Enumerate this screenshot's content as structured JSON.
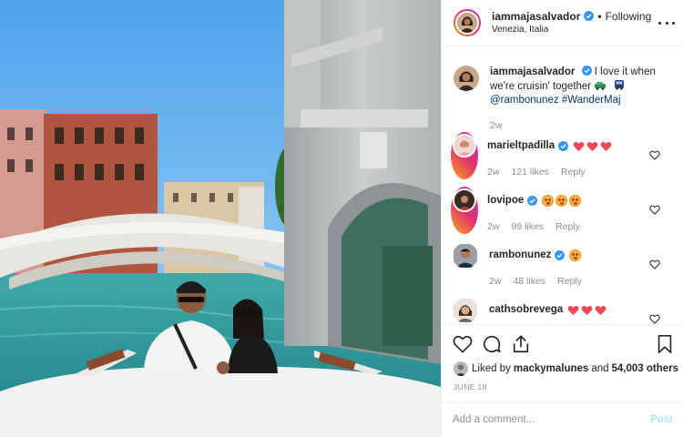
{
  "header": {
    "username": "iammajasalvador",
    "separator": "•",
    "follow_status": "Following",
    "location": "Venezia, Italia"
  },
  "caption": {
    "username": "iammajasalvador",
    "text_1": "I love it when we're cruisin' together",
    "mention": "@rambonunez",
    "hashtag": "#WanderMaj",
    "age": "2w"
  },
  "comments": [
    {
      "username": "marieltpadilla",
      "emoji": [
        "red-heart",
        "red-heart",
        "red-heart"
      ],
      "age": "2w",
      "likes": "121 likes",
      "reply": "Reply",
      "verified": true
    },
    {
      "username": "lovipoe",
      "emoji": [
        "heart-eyes-face",
        "heart-eyes-face",
        "heart-eyes-face"
      ],
      "age": "2w",
      "likes": "99 likes",
      "reply": "Reply",
      "verified": true
    },
    {
      "username": "rambonunez",
      "emoji": [
        "heart-eyes-face"
      ],
      "age": "2w",
      "likes": "48 likes",
      "reply": "Reply",
      "verified": true
    },
    {
      "username": "cathsobrevega",
      "emoji": [
        "red-heart",
        "red-heart",
        "red-heart"
      ],
      "age": "",
      "likes": "",
      "reply": "",
      "verified": false
    }
  ],
  "likes": {
    "prefix": "Liked by",
    "user": "mackymalunes",
    "connector": "and",
    "others": "54,003 others"
  },
  "date": "JUNE 18",
  "add_comment": {
    "placeholder": "Add a comment...",
    "post_label": "Post"
  },
  "colors": {
    "link": "#00376b",
    "muted": "#8e8e8e",
    "verified": "#3897f0",
    "post_disabled": "#b2dffc",
    "heart_emoji": "#ed4956"
  },
  "icons": [
    "verified-badge-icon",
    "more-options-icon",
    "heart-icon",
    "comment-icon",
    "share-icon",
    "bookmark-icon",
    "red-heart-emoji",
    "heart-eyes-emoji",
    "car-emoji",
    "bus-emoji"
  ]
}
